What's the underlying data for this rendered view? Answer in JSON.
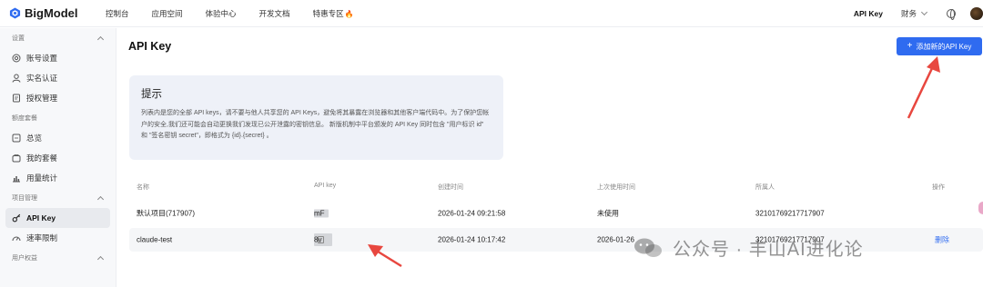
{
  "header": {
    "brand": "BigModel",
    "nav": [
      "控制台",
      "应用空间",
      "体验中心",
      "开发文档",
      "特惠专区"
    ],
    "right": {
      "apikey": "API Key",
      "finance": "财务"
    }
  },
  "sidebar": {
    "sections": [
      {
        "title": "设置",
        "items": [
          {
            "label": "账号设置",
            "icon": "settings-icon"
          },
          {
            "label": "实名认证",
            "icon": "user-icon"
          },
          {
            "label": "授权管理",
            "icon": "document-icon"
          }
        ]
      },
      {
        "title": "额度套餐",
        "items": [
          {
            "label": "总览",
            "icon": "overview-icon"
          },
          {
            "label": "我的套餐",
            "icon": "package-icon"
          },
          {
            "label": "用量统计",
            "icon": "chart-icon"
          }
        ]
      },
      {
        "title": "项目管理",
        "items": [
          {
            "label": "API Key",
            "icon": "key-icon",
            "active": true
          },
          {
            "label": "速率限制",
            "icon": "speed-icon"
          }
        ]
      },
      {
        "title": "用户权益",
        "items": []
      }
    ]
  },
  "main": {
    "title": "API Key",
    "add_button": "添加新的API Key",
    "tip": {
      "title": "提示",
      "body": "列表内是您的全部 API keys，请不要与他人共享您的 API Keys，避免将其暴露在浏览器和其他客户端代码中。为了保护您帐户的安全,我们还可能会自动更换我们发现已公开泄露的密钥信息。 新版机制中平台颁发的 API Key 同时包含 \"用户标识 id\" 和 \"签名密钥 secret\"，即格式为 {id}.{secret} 。"
    },
    "table": {
      "columns": [
        "名称",
        "API key",
        "创建时间",
        "上次使用时间",
        "所属人",
        "操作"
      ],
      "rows": [
        {
          "name": "默认项目(717907)",
          "key_suffix": "mF",
          "created": "2026-01-24 09:21:58",
          "last_used": "未使用",
          "owner": "32101769217717907",
          "action": ""
        },
        {
          "name": "claude-test",
          "key_suffix": "8v",
          "created": "2026-01-24 10:17:42",
          "last_used": "2026-01-26",
          "owner": "32101769217717907",
          "action": "删除"
        }
      ]
    }
  },
  "watermark": "公众号 · 丰山AI进化论",
  "colors": {
    "primary": "#2f6bf0",
    "annotation_arrow": "#e8473f",
    "tip_bg": "#eef1f8"
  }
}
